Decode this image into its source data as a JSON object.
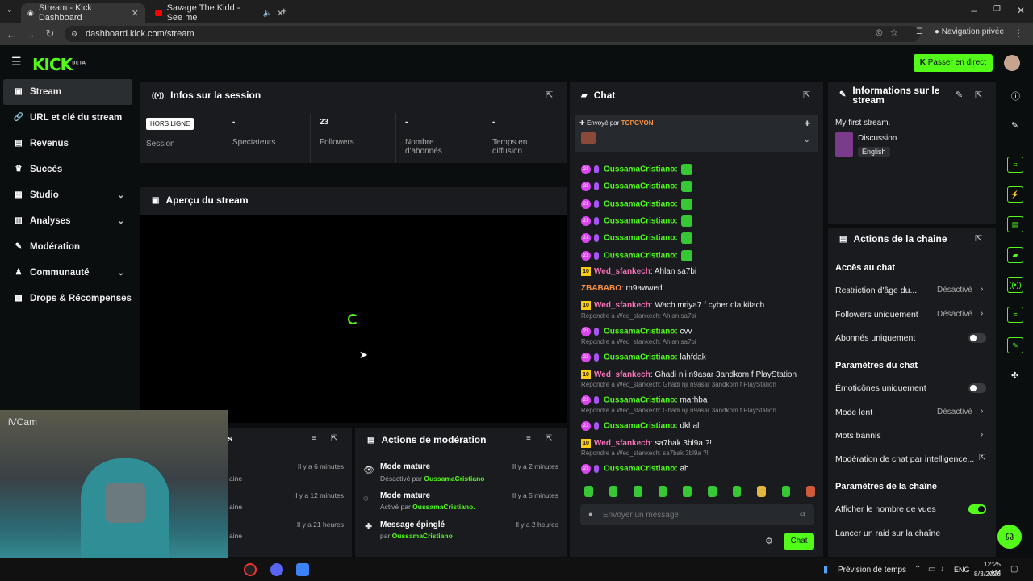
{
  "browser": {
    "tabs": [
      {
        "title": "Stream - Kick Dashboard",
        "active": true
      },
      {
        "title": "Savage The Kidd - See me",
        "active": false
      }
    ],
    "url": "dashboard.kick.com/stream",
    "incognito_label": "Navigation privée"
  },
  "app": {
    "logo": "KICK",
    "logo_tag": "BETA",
    "go_live": "Passer en direct"
  },
  "sidebar": {
    "items": [
      {
        "label": "Stream",
        "active": true
      },
      {
        "label": "URL et clé du stream"
      },
      {
        "label": "Revenus"
      },
      {
        "label": "Succès"
      },
      {
        "label": "Studio",
        "expandable": true
      },
      {
        "label": "Analyses",
        "expandable": true
      },
      {
        "label": "Modération"
      },
      {
        "label": "Communauté",
        "expandable": true
      },
      {
        "label": "Drops & Récompenses"
      }
    ]
  },
  "session": {
    "title": "Infos sur la session",
    "status_badge": "HORS LIGNE",
    "session_label": "Session",
    "spectators_value": "-",
    "spectators_label": "Spectateurs",
    "followers_value": "23",
    "followers_label": "Followers",
    "subs_value": "-",
    "subs_label": "Nombre d'abonnés",
    "airtime_value": "-",
    "airtime_label": "Temps en diffusion"
  },
  "preview": {
    "title": "Aperçu du stream"
  },
  "moderation": {
    "title": "Actions de modération",
    "items": [
      {
        "title": "Mode mature",
        "sub_prefix": "Désactivé par ",
        "user": "OussamaCristiano",
        "time": "Il y a 2 minutes"
      },
      {
        "title": "Mode mature",
        "sub_prefix": "Activé par ",
        "user": "OussamaCristiano.",
        "time": "Il y a 5 minutes"
      },
      {
        "title": "Message épinglé",
        "sub_prefix": "par ",
        "user": "OussamaCristiano",
        "time": "Il y a 2 heures"
      }
    ],
    "left_times": [
      "Il y a 6 minutes",
      "Il y a 12 minutes",
      "Il y a 21 heures"
    ],
    "left_subs": [
      "aine",
      "aine",
      "aine"
    ]
  },
  "chat": {
    "title": "Chat",
    "pinned_prefix": "Envoyé par ",
    "pinned_user": "TOPGVON",
    "messages": [
      {
        "type": "emote",
        "user": "OussamaCristiano:"
      },
      {
        "type": "emote",
        "user": "OussamaCristiano:"
      },
      {
        "type": "emote",
        "user": "OussamaCristiano:"
      },
      {
        "type": "emote",
        "user": "OussamaCristiano:"
      },
      {
        "type": "emote",
        "user": "OussamaCristiano:"
      },
      {
        "type": "emote",
        "user": "OussamaCristiano:"
      },
      {
        "type": "text10",
        "user": "Wed_sfankech",
        "text": ": Ahlan sa7bi"
      },
      {
        "type": "plain",
        "user": "ZBABABO",
        "text": ": m9awwed"
      },
      {
        "type": "text10",
        "user": "Wed_sfankech",
        "text": ": Wach mriya7 f cyber ola kifach"
      },
      {
        "type": "reply",
        "reply": "Répondre à Wed_sfankech: Ahlan sa7bi",
        "user": "OussamaCristiano:",
        "text": " cvv"
      },
      {
        "type": "reply",
        "reply": "Répondre à Wed_sfankech: Ahlan sa7bi",
        "user": "OussamaCristiano:",
        "text": " lahfdak"
      },
      {
        "type": "text10",
        "user": "Wed_sfankech",
        "text": ": Ghadi nji n9asar 3andkom f PlayStation"
      },
      {
        "type": "reply",
        "reply": "Répondre à Wed_sfankech: Ghadi nji n9asar 3andkom f PlayStation",
        "user": "OussamaCristiano:",
        "text": " marhba"
      },
      {
        "type": "reply",
        "reply": "Répondre à Wed_sfankech: Ghadi nji n9asar 3andkom f PlayStation",
        "user": "OussamaCristiano:",
        "text": " dkhal"
      },
      {
        "type": "text10",
        "user": "Wed_sfankech",
        "text": ": sa7bak 3bl9a ?!"
      },
      {
        "type": "reply",
        "reply": "Répondre à Wed_sfankech: sa7bak 3bl9a ?!",
        "user": "OussamaCristiano:",
        "text": " ah"
      }
    ],
    "input_placeholder": "Envoyer un message",
    "send_label": "Chat"
  },
  "stream_info": {
    "title": "Informations sur le stream",
    "stream_title": "My first stream.",
    "category": "Discussion",
    "language": "English"
  },
  "channel_actions": {
    "title": "Actions de la chaîne",
    "chat_access": "Accès au chat",
    "age_restriction": "Restriction d'âge du...",
    "age_value": "Désactivé",
    "followers_only": "Followers uniquement",
    "followers_value": "Désactivé",
    "subs_only": "Abonnés uniquement",
    "chat_settings": "Paramètres du chat",
    "emotes_only": "Émoticônes uniquement",
    "slow_mode": "Mode lent",
    "slow_value": "Désactivé",
    "banned_words": "Mots bannis",
    "ai_moderation": "Modération de chat par intelligence...",
    "channel_settings": "Paramètres de la chaîne",
    "show_views": "Afficher le nombre de vues",
    "raid": "Lancer un raid sur la chaîne"
  },
  "webcam": {
    "label": "iVCam"
  },
  "taskbar": {
    "weather": "Prévision de temps",
    "lang": "ENG",
    "time": "12:25 AM",
    "date": "8/3/2026"
  },
  "colors": {
    "accent": "#53fc18",
    "panel": "#191b1f",
    "background": "#0b0e0f"
  }
}
